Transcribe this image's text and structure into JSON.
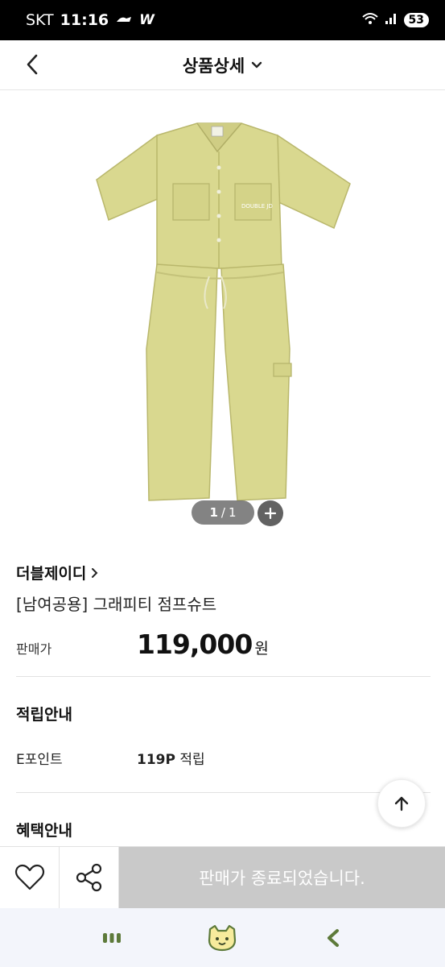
{
  "status_bar": {
    "carrier": "SKT",
    "time": "11:16",
    "battery": "53"
  },
  "header": {
    "title": "상품상세"
  },
  "gallery": {
    "current": "1",
    "separator": "/",
    "total": "1"
  },
  "product": {
    "brand": "더블제이디",
    "name": "[남여공용] 그래피티 점프슈트",
    "price_label": "판매가",
    "price_value": "119,000",
    "price_unit": "원"
  },
  "points": {
    "section_title": "적립안내",
    "label": "E포인트",
    "value": "119P",
    "value_suffix": "적립"
  },
  "benefits": {
    "section_title": "혜택안내"
  },
  "action_bar": {
    "soldout_label": "판매가 종료되었습니다."
  },
  "icons": {
    "back": "chevron-left-icon",
    "title_dropdown": "chevron-down-icon",
    "zoom": "plus-icon",
    "scroll_top": "arrow-up-icon",
    "wishlist": "heart-icon",
    "share": "share-icon",
    "nav_recent": "recent-apps-icon",
    "nav_home": "home-icon",
    "nav_back": "back-icon"
  },
  "colors": {
    "soldout_bg": "#c9c9c9",
    "product_fabric": "#d9d88f",
    "nav_bg": "#f3f5fb",
    "nav_accent": "#5d7a3a"
  }
}
